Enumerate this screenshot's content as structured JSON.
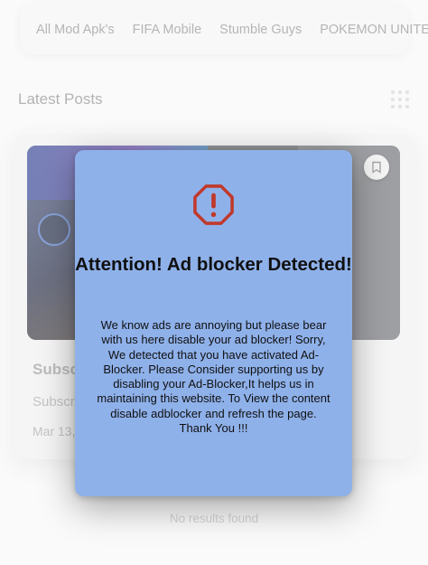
{
  "tabs": [
    "All Mod Apk's",
    "FIFA Mobile",
    "Stumble Guys",
    "POKEMON UNITE"
  ],
  "latest_posts": {
    "title": "Latest Posts"
  },
  "post": {
    "title": "Subsc",
    "subtitle": "Subscri",
    "date": "Mar 13,"
  },
  "no_results": "No results found",
  "modal": {
    "title": "Attention! Ad blocker Detected!",
    "body": "We know ads are annoying but please bear with us here disable your ad blocker! Sorry, We detected that you have activated Ad-Blocker. Please Consider supporting us by disabling your Ad-Blocker,It helps us in maintaining this website. To View the content disable adblocker and refresh the page. Thank You !!!",
    "icon": "warning-octagon-icon"
  },
  "colors": {
    "modal_bg": "#8fb1ea",
    "warning": "#c0392b"
  }
}
